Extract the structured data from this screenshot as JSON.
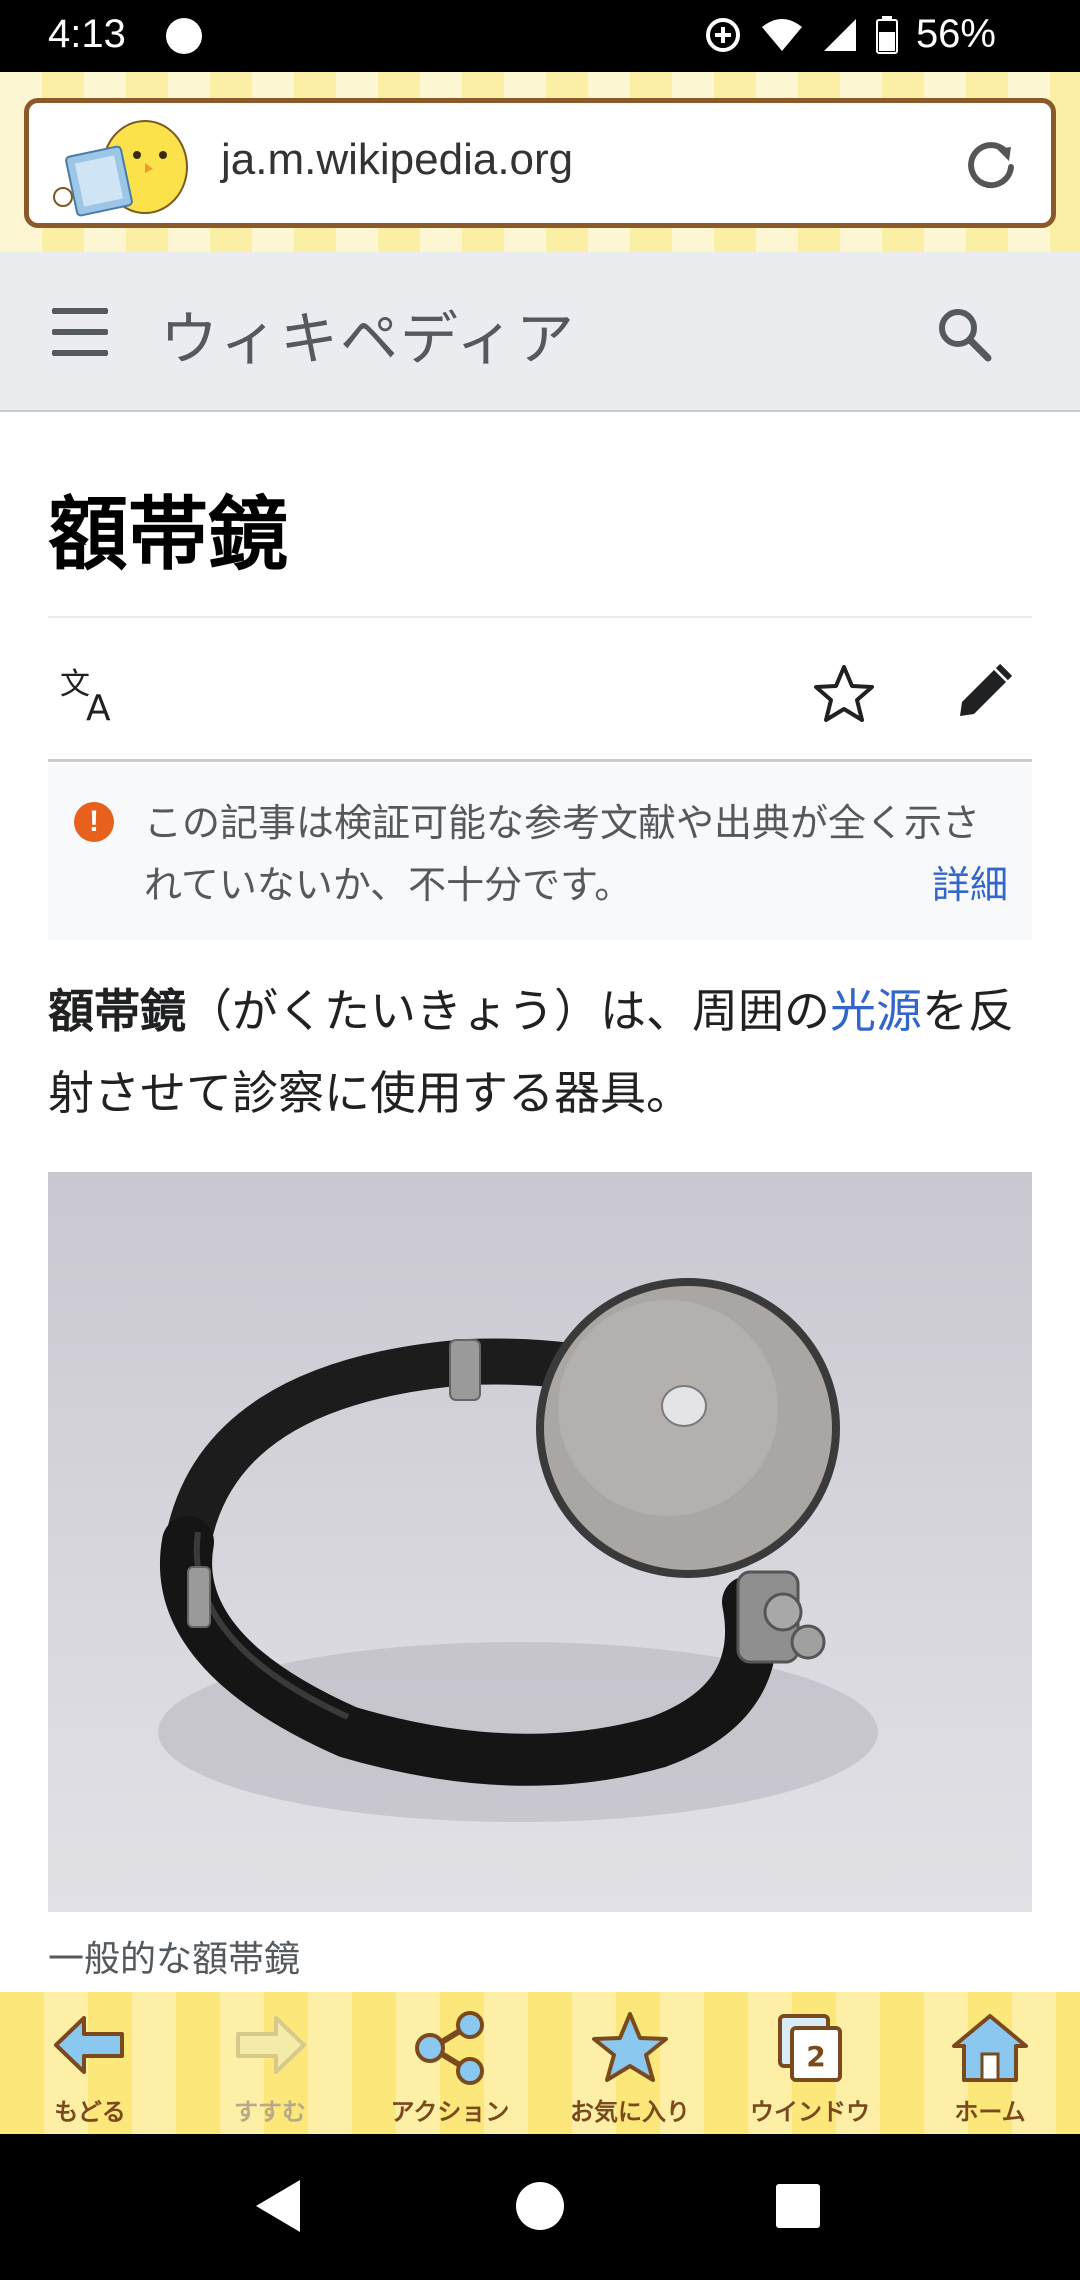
{
  "status": {
    "time": "4:13",
    "battery": "56%"
  },
  "browser": {
    "url": "ja.m.wikipedia.org"
  },
  "wiki": {
    "site_title": "ウィキペディア"
  },
  "article": {
    "title": "額帯鏡",
    "notice_text": "この記事は検証可能な参考文献や出典が全く示されていないか、不十分です。",
    "notice_more": "詳細",
    "lead_bold": "額帯鏡",
    "lead_part1": "（がくたいきょう）は、周囲の",
    "lead_link": "光源",
    "lead_part2": "を反射させて診察に使用する器具。",
    "caption": "一般的な額帯鏡"
  },
  "toolbar": {
    "items": [
      {
        "label": "もどる",
        "icon": "back-arrow-icon"
      },
      {
        "label": "すすむ",
        "icon": "forward-arrow-icon"
      },
      {
        "label": "アクション",
        "icon": "share-icon"
      },
      {
        "label": "お気に入り",
        "icon": "star-icon"
      },
      {
        "label": "ウインドウ",
        "icon": "window-icon",
        "count": "2"
      },
      {
        "label": "ホーム",
        "icon": "home-icon"
      }
    ]
  },
  "colors": {
    "link": "#3366cc",
    "toolbar_yellow": "#fbe77a",
    "toolbar_text": "#7a4a1e",
    "notice_icon": "#e8601d"
  }
}
